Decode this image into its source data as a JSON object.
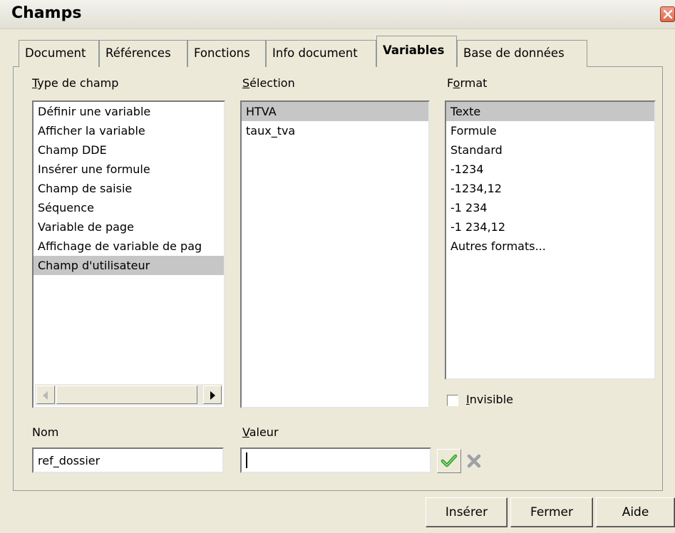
{
  "window": {
    "title": "Champs"
  },
  "tabs": [
    {
      "label": "Document"
    },
    {
      "label": "Références"
    },
    {
      "label": "Fonctions"
    },
    {
      "label": "Info document"
    },
    {
      "label": "Variables"
    },
    {
      "label": "Base de données"
    }
  ],
  "type_champ": {
    "label_u": "T",
    "label_rest": "ype de champ",
    "items": [
      "Définir une variable",
      "Afficher la variable",
      "Champ DDE",
      "Insérer une formule",
      "Champ de saisie",
      "Séquence",
      "Variable de page",
      "Affichage de variable de pag",
      "Champ d'utilisateur"
    ],
    "selected_index": 8
  },
  "selection": {
    "label_u": "S",
    "label_rest": "élection",
    "items": [
      "HTVA",
      "taux_tva"
    ],
    "selected_index": 0
  },
  "format": {
    "label_pre": "F",
    "label_u": "o",
    "label_rest": "rmat",
    "items": [
      "Texte",
      "Formule",
      "Standard",
      "-1234",
      "-1234,12",
      "-1 234",
      "-1 234,12",
      "Autres formats..."
    ],
    "selected_index": 0
  },
  "invisible": {
    "label_u": "I",
    "label_rest": "nvisible",
    "checked": false
  },
  "nom": {
    "label": "Nom",
    "value": "ref_dossier"
  },
  "valeur": {
    "label_u": "V",
    "label_rest": "aleur",
    "value": ""
  },
  "buttons": {
    "inserer": "Insérer",
    "fermer": "Fermer",
    "aide": "Aide"
  },
  "icons": {
    "apply": "check-icon",
    "cancel": "cross-icon",
    "close": "close-icon"
  }
}
